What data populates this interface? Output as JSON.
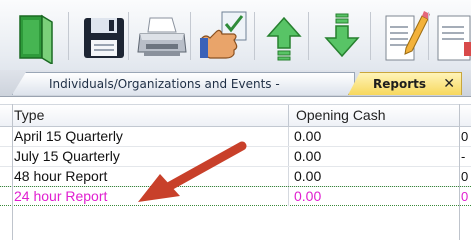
{
  "toolbar": {
    "buttons": [
      {
        "icon": "book-icon"
      },
      {
        "icon": "save-icon"
      },
      {
        "icon": "printer-icon"
      },
      {
        "icon": "thumbs-up-checklist-icon"
      },
      {
        "icon": "arrow-up-icon"
      },
      {
        "icon": "arrow-down-icon"
      },
      {
        "icon": "edit-document-icon"
      },
      {
        "icon": "report-icon"
      }
    ]
  },
  "tabs": {
    "individuals_label": "Individuals/Organizations and Events -",
    "reports_label": "Reports",
    "close_symbol": "✕"
  },
  "grid": {
    "columns": [
      "Type",
      "Opening Cash"
    ],
    "rows": [
      {
        "type": "April 15 Quarterly",
        "cash": "0.00",
        "edge": "0"
      },
      {
        "type": "July 15 Quarterly",
        "cash": "0.00",
        "edge": "-"
      },
      {
        "type": "48 hour Report",
        "cash": "0.00",
        "edge": "0"
      },
      {
        "type": "24 hour Report",
        "cash": "0.00",
        "edge": "0"
      }
    ],
    "selected_row": 3
  },
  "colors": {
    "selected_text": "#e020d0",
    "arrow": "#c8402a",
    "reports_tab": "#f7d85e"
  }
}
